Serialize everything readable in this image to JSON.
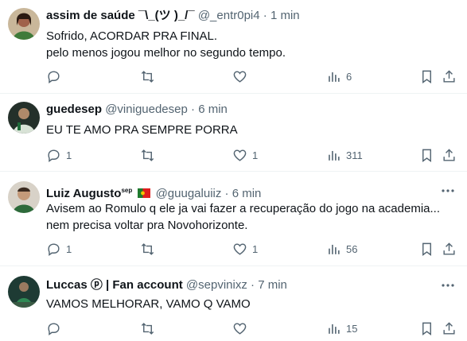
{
  "posts": [
    {
      "display_name": "assim de saúde ¯\\_(ツ )_/¯",
      "handle": "@_entr0pi4",
      "sep": "·",
      "time": "1 min",
      "text": "Sofrido, ACORDAR PRA FINAL.\npelo menos jogou melhor no segundo tempo.",
      "replies": "",
      "reposts": "",
      "likes": "",
      "views": "6",
      "avatar_color": "#a0624a"
    },
    {
      "display_name": "guedesep",
      "handle": "@viniguedesep",
      "sep": "·",
      "time": "6 min",
      "text": "EU TE AMO PRA SEMPRE PORRA",
      "replies": "1",
      "reposts": "",
      "likes": "1",
      "views": "311",
      "avatar_color": "#3d4a3a"
    },
    {
      "display_name": "Luiz Augusto",
      "name_suffix": "sep",
      "handle": "@guugaluiiz",
      "sep": "·",
      "time": "6 min",
      "text": "Avisem ao Romulo q ele ja vai fazer a recuperação do jogo na academia...\nnem precisa voltar pra Novohorizonte.",
      "replies": "1",
      "reposts": "",
      "likes": "1",
      "views": "56",
      "avatar_color": "#8a7a6a"
    },
    {
      "display_name": "Luccas ⓟ | Fan account",
      "handle": "@sepvinixz",
      "sep": "·",
      "time": "7 min",
      "text": "VAMOS MELHORAR, VAMO Q VAMO",
      "replies": "",
      "reposts": "",
      "likes": "",
      "views": "15",
      "avatar_color": "#2e5a4a"
    }
  ],
  "colors": {
    "text": "#0f1419",
    "muted": "#536471",
    "divider": "#eff3f4"
  }
}
